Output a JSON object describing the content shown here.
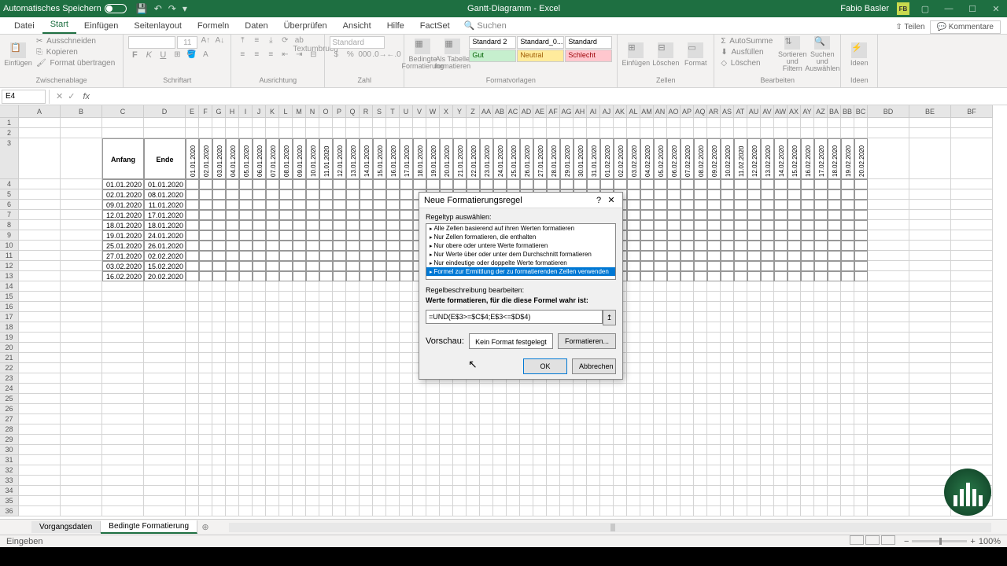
{
  "title": {
    "autosave": "Automatisches Speichern",
    "doc": "Gantt-Diagramm - Excel",
    "user": "Fabio Basler",
    "initials": "FB"
  },
  "tabs": {
    "datei": "Datei",
    "start": "Start",
    "einfuegen": "Einfügen",
    "seitenlayout": "Seitenlayout",
    "formeln": "Formeln",
    "daten": "Daten",
    "ueberpruefen": "Überprüfen",
    "ansicht": "Ansicht",
    "hilfe": "Hilfe",
    "factset": "FactSet",
    "suchen": "Suchen",
    "teilen": "Teilen",
    "kommentare": "Kommentare"
  },
  "ribbon": {
    "zwischenablage": "Zwischenablage",
    "schriftart": "Schriftart",
    "ausrichtung": "Ausrichtung",
    "zahl": "Zahl",
    "formatvorlagen": "Formatvorlagen",
    "zellen": "Zellen",
    "bearbeiten": "Bearbeiten",
    "ideen": "Ideen",
    "einfuegen": "Einfügen",
    "ausschneiden": "Ausschneiden",
    "kopieren": "Kopieren",
    "format_uebertragen": "Format übertragen",
    "fontsize": "11",
    "textumbruch": "Textumbruch",
    "standard": "Standard",
    "bedingte": "Bedingte\nFormatierung",
    "als_tabelle": "Als Tabelle\nformatieren",
    "std2": "Standard 2",
    "std0": "Standard_0...",
    "std": "Standard",
    "gut": "Gut",
    "neutral": "Neutral",
    "schlecht": "Schlecht",
    "z_einf": "Einfügen",
    "z_loesch": "Löschen",
    "z_format": "Format",
    "autosumme": "AutoSumme",
    "ausfuellen": "Ausfüllen",
    "loeschen": "Löschen",
    "sortieren": "Sortieren und\nFiltern",
    "suchen_aus": "Suchen und\nAuswählen",
    "ideen_btn": "Ideen"
  },
  "namebox": "E4",
  "cols_main": [
    "A",
    "B",
    "C",
    "D"
  ],
  "cols_narrow": [
    "E",
    "F",
    "G",
    "H",
    "I",
    "J",
    "K",
    "L",
    "M",
    "N",
    "O",
    "P",
    "Q",
    "R",
    "S",
    "T",
    "U",
    "V",
    "W",
    "X",
    "Y",
    "Z",
    "AA",
    "AB",
    "AC",
    "AD",
    "AE",
    "AF",
    "AG",
    "AH",
    "AI",
    "AJ",
    "AK",
    "AL",
    "AM",
    "AN",
    "AO",
    "AP",
    "AQ",
    "AR",
    "AS",
    "AT",
    "AU",
    "AV",
    "AW",
    "AX",
    "AY",
    "AZ",
    "BA",
    "BB",
    "BC"
  ],
  "cols_wide_end": [
    "BD",
    "BE",
    "BF"
  ],
  "headers": {
    "anfang": "Anfang",
    "ende": "Ende"
  },
  "dates_row": [
    "01.01.2020",
    "02.01.2020",
    "03.01.2020",
    "04.01.2020",
    "05.01.2020",
    "06.01.2020",
    "07.01.2020",
    "08.01.2020",
    "09.01.2020",
    "10.01.2020",
    "11.01.2020",
    "12.01.2020",
    "13.01.2020",
    "14.01.2020",
    "15.01.2020",
    "16.01.2020",
    "17.01.2020",
    "18.01.2020",
    "19.01.2020",
    "20.01.2020",
    "21.01.2020",
    "22.01.2020",
    "23.01.2020",
    "24.01.2020",
    "25.01.2020",
    "26.01.2020",
    "27.01.2020",
    "28.01.2020",
    "29.01.2020",
    "30.01.2020",
    "31.01.2020",
    "01.02.2020",
    "02.02.2020",
    "03.02.2020",
    "04.02.2020",
    "05.02.2020",
    "06.02.2020",
    "07.02.2020",
    "08.02.2020",
    "09.02.2020",
    "10.02.2020",
    "11.02.2020",
    "12.02.2020",
    "13.02.2020",
    "14.02.2020",
    "15.02.2020",
    "16.02.2020",
    "17.02.2020",
    "18.02.2020",
    "19.02.2020",
    "20.02.2020"
  ],
  "tasks": [
    {
      "start": "01.01.2020",
      "end": "01.01.2020"
    },
    {
      "start": "02.01.2020",
      "end": "08.01.2020"
    },
    {
      "start": "09.01.2020",
      "end": "11.01.2020"
    },
    {
      "start": "12.01.2020",
      "end": "17.01.2020"
    },
    {
      "start": "18.01.2020",
      "end": "18.01.2020"
    },
    {
      "start": "19.01.2020",
      "end": "24.01.2020"
    },
    {
      "start": "25.01.2020",
      "end": "26.01.2020"
    },
    {
      "start": "27.01.2020",
      "end": "02.02.2020"
    },
    {
      "start": "03.02.2020",
      "end": "15.02.2020"
    },
    {
      "start": "16.02.2020",
      "end": "20.02.2020"
    }
  ],
  "dialog": {
    "title": "Neue Formatierungsregel",
    "regeltyp": "Regeltyp auswählen:",
    "rules": [
      "Alle Zellen basierend auf ihren Werten formatieren",
      "Nur Zellen formatieren, die enthalten",
      "Nur obere oder untere Werte formatieren",
      "Nur Werte über oder unter dem Durchschnitt formatieren",
      "Nur eindeutige oder doppelte Werte formatieren",
      "Formel zur Ermittlung der zu formatierenden Zellen verwenden"
    ],
    "beschreibung": "Regelbeschreibung bearbeiten:",
    "formel_lbl": "Werte formatieren, für die diese Formel wahr ist:",
    "formel": "=UND(E$3>=$C$4;E$3<=$D$4)",
    "vorschau": "Vorschau:",
    "kein_format": "Kein Format festgelegt",
    "formatieren": "Formatieren...",
    "ok": "OK",
    "abbrechen": "Abbrechen"
  },
  "sheets": {
    "s1": "Vorgangsdaten",
    "s2": "Bedingte Formatierung"
  },
  "status": {
    "mode": "Eingeben",
    "zoom": "100%"
  }
}
